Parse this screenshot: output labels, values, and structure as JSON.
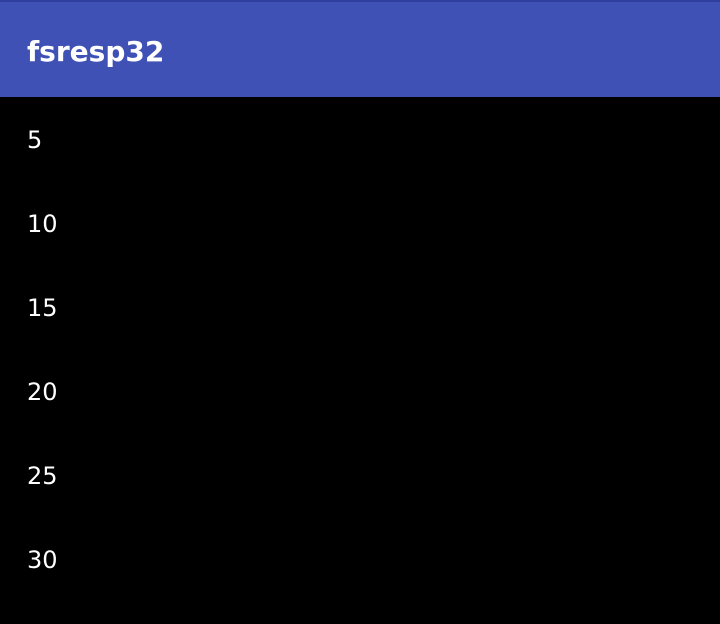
{
  "app_bar": {
    "title": "fsresp32",
    "color": "#3F51B5"
  },
  "list": {
    "items": [
      {
        "label": "5"
      },
      {
        "label": "10"
      },
      {
        "label": "15"
      },
      {
        "label": "20"
      },
      {
        "label": "25"
      },
      {
        "label": "30"
      }
    ]
  },
  "colors": {
    "background": "#000000",
    "text": "#FFFFFF"
  }
}
